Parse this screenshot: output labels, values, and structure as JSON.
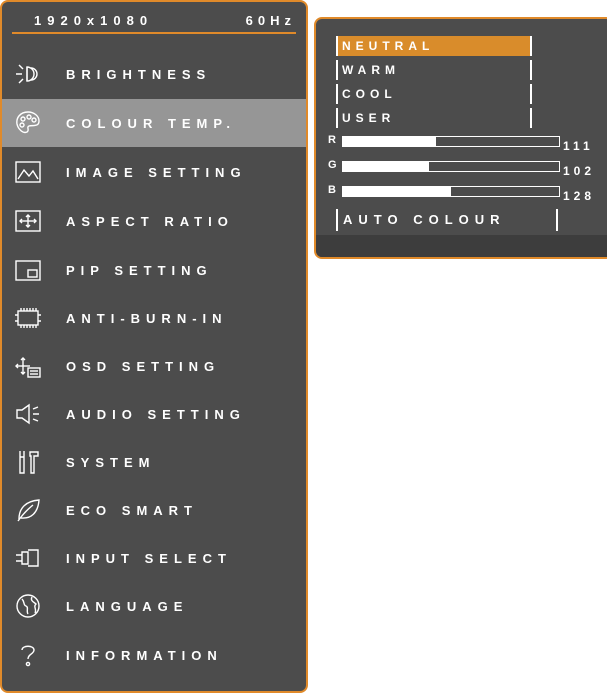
{
  "status": {
    "resolution": "1920x1080",
    "refresh": "60Hz"
  },
  "menu": {
    "items": [
      {
        "label": "BRIGHTNESS",
        "icon": "brightness-icon"
      },
      {
        "label": "COLOUR TEMP.",
        "icon": "palette-icon",
        "selected": true
      },
      {
        "label": "IMAGE SETTING",
        "icon": "image-icon"
      },
      {
        "label": "ASPECT RATIO",
        "icon": "aspect-ratio-icon"
      },
      {
        "label": "PIP SETTING",
        "icon": "pip-icon"
      },
      {
        "label": "ANTI-BURN-IN",
        "icon": "chip-icon"
      },
      {
        "label": "OSD SETTING",
        "icon": "osd-icon"
      },
      {
        "label": "AUDIO SETTING",
        "icon": "speaker-icon"
      },
      {
        "label": "SYSTEM",
        "icon": "tools-icon"
      },
      {
        "label": "ECO SMART",
        "icon": "leaf-icon"
      },
      {
        "label": "INPUT SELECT",
        "icon": "input-plug-icon"
      },
      {
        "label": "LANGUAGE",
        "icon": "globe-icon"
      },
      {
        "label": "INFORMATION",
        "icon": "question-icon"
      }
    ]
  },
  "submenu": {
    "options": [
      {
        "label": "NEUTRAL",
        "selected": true
      },
      {
        "label": "WARM"
      },
      {
        "label": "COOL"
      },
      {
        "label": "USER"
      }
    ],
    "rgb": [
      {
        "channel": "R",
        "value": "111",
        "level": 0.43
      },
      {
        "channel": "G",
        "value": "102",
        "level": 0.4
      },
      {
        "channel": "B",
        "value": "128",
        "level": 0.5
      }
    ],
    "auto_label": "AUTO COLOUR"
  },
  "colors": {
    "accent": "#e08a2a",
    "panel": "#4c4c4c",
    "highlight": "#969696",
    "selected_option": "#d98c2b"
  }
}
